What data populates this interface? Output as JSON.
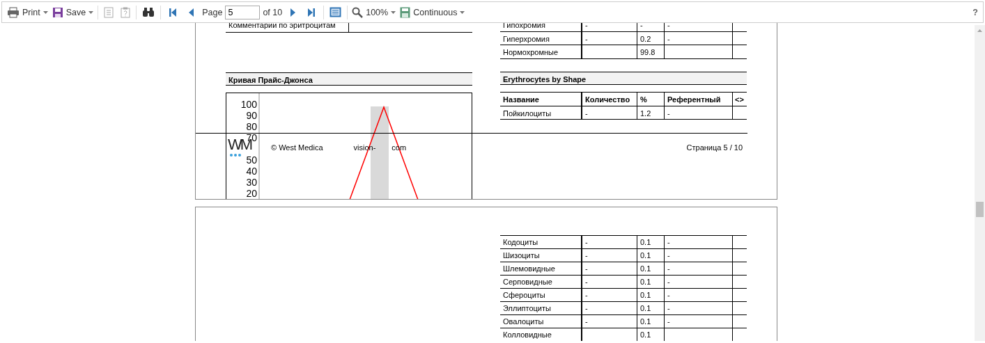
{
  "toolbar": {
    "print_button": {
      "label": "Print"
    },
    "save_button": {
      "label": "Save"
    },
    "document_buttons": [
      {
        "disabled": true
      },
      {
        "disabled": true
      }
    ],
    "page_label": "Page",
    "page_value": "5",
    "page_total": "of 10",
    "zoom_button": {
      "label": "100%"
    },
    "view_mode_button": {
      "label": "Continuous"
    },
    "help": "?"
  },
  "page_1": {
    "comment_row": {
      "label": "Комментарии по эритроцитам"
    },
    "chromia_rows": [
      {
        "name": "Гипохромия",
        "count": "-",
        "percent": "-",
        "reference": "-"
      },
      {
        "name": "Гиперхромия",
        "count": "-",
        "percent": "0.2",
        "reference": "-"
      },
      {
        "name": "Нормохромные",
        "percent": "99.8"
      }
    ],
    "price_jones": {
      "title": "Кривая Прайс-Джонса",
      "y_ticks_upper": [
        "100",
        "90",
        "80",
        "70"
      ],
      "y_ticks_lower": [
        "50",
        "40",
        "30",
        "20"
      ]
    },
    "shape_section": {
      "title": "Erythrocytes by Shape",
      "columns": [
        "Название",
        "Количество",
        "%",
        "Референтный",
        "<>"
      ],
      "rows": [
        {
          "name": "Пойкилоциты",
          "count": "-",
          "percent": "1.2",
          "reference": "-"
        }
      ]
    },
    "footer": {
      "logo_text": "WM",
      "copyright": "© West Medica",
      "url_start": "vision-",
      "url_end": "com",
      "page_number": "Страница 5 / 10"
    }
  },
  "page_2": {
    "shape_rows": [
      {
        "name": "Кодоциты",
        "count": "-",
        "percent": "0.1",
        "reference": "-"
      },
      {
        "name": "Шизоциты",
        "count": "-",
        "percent": "0.1",
        "reference": "-"
      },
      {
        "name": "Шлемовидные",
        "count": "-",
        "percent": "0.1",
        "reference": "-"
      },
      {
        "name": "Серповидные",
        "count": "-",
        "percent": "0.1",
        "reference": "-"
      },
      {
        "name": "Сфероциты",
        "count": "-",
        "percent": "0.1",
        "reference": "-"
      },
      {
        "name": "Эллиптоциты",
        "count": "-",
        "percent": "0.1",
        "reference": "-"
      },
      {
        "name": "Овалоциты",
        "count": "-",
        "percent": "0.1",
        "reference": "-"
      },
      {
        "name": "Колловидные",
        "percent": "0.1"
      }
    ]
  }
}
